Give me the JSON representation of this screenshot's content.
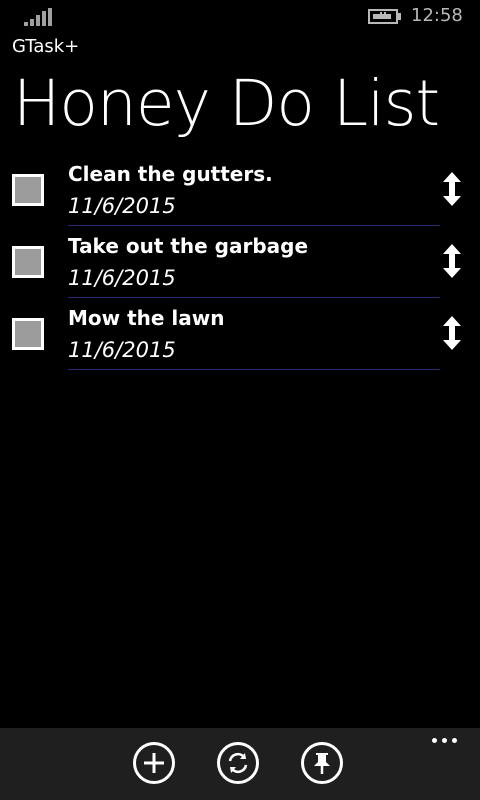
{
  "status_bar": {
    "time": "12:58",
    "signal_icon": "signal-strength-icon",
    "battery_icon": "battery-charging-icon"
  },
  "app": {
    "name": "GTask+"
  },
  "page": {
    "title": "Honey Do List"
  },
  "tasks": [
    {
      "title": "Clean the gutters.",
      "date": "11/6/2015",
      "completed": false
    },
    {
      "title": "Take out the garbage",
      "date": "11/6/2015",
      "completed": false
    },
    {
      "title": "Mow the lawn",
      "date": "11/6/2015",
      "completed": false
    }
  ],
  "app_bar": {
    "buttons": [
      {
        "icon": "add-icon"
      },
      {
        "icon": "sync-icon"
      },
      {
        "icon": "pin-icon"
      }
    ],
    "more_icon": "more-options-icon"
  },
  "colors": {
    "background": "#000000",
    "checkbox_fill": "#9b9b9b",
    "divider": "#2a2a70",
    "app_bar": "#1f1f1f",
    "status_text": "#b8b8b8"
  }
}
